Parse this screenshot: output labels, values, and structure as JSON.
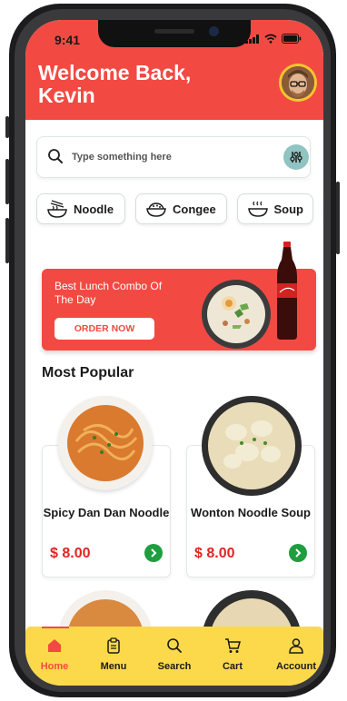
{
  "status": {
    "time": "9:41"
  },
  "header": {
    "welcome": "Welcome Back,\nKevin"
  },
  "search": {
    "placeholder": "Type something here"
  },
  "categories": [
    {
      "label": "Noodle",
      "icon": "noodle-bowl-icon"
    },
    {
      "label": "Congee",
      "icon": "congee-bowl-icon"
    },
    {
      "label": "Soup",
      "icon": "soup-bowl-icon"
    }
  ],
  "banner": {
    "title": "Best Lunch Combo Of The Day",
    "button": "ORDER NOW"
  },
  "popular": {
    "title": "Most Popular",
    "items": [
      {
        "name": "Spicy Dan Dan Noodle",
        "price": "$ 8.00"
      },
      {
        "name": "Wonton Noodle Soup",
        "price": "$ 8.00"
      }
    ]
  },
  "nav": {
    "items": [
      {
        "label": "Home",
        "icon": "home-icon",
        "active": true
      },
      {
        "label": "Menu",
        "icon": "menu-clipboard-icon",
        "active": false
      },
      {
        "label": "Search",
        "icon": "search-icon",
        "active": false
      },
      {
        "label": "Cart",
        "icon": "cart-icon",
        "active": false
      },
      {
        "label": "Account",
        "icon": "account-icon",
        "active": false
      }
    ]
  },
  "colors": {
    "brand_red": "#f24a43",
    "nav_yellow": "#fbd94a",
    "price_red": "#e02424",
    "go_green": "#1e9e3e",
    "filter_teal": "#8fc4c2"
  }
}
